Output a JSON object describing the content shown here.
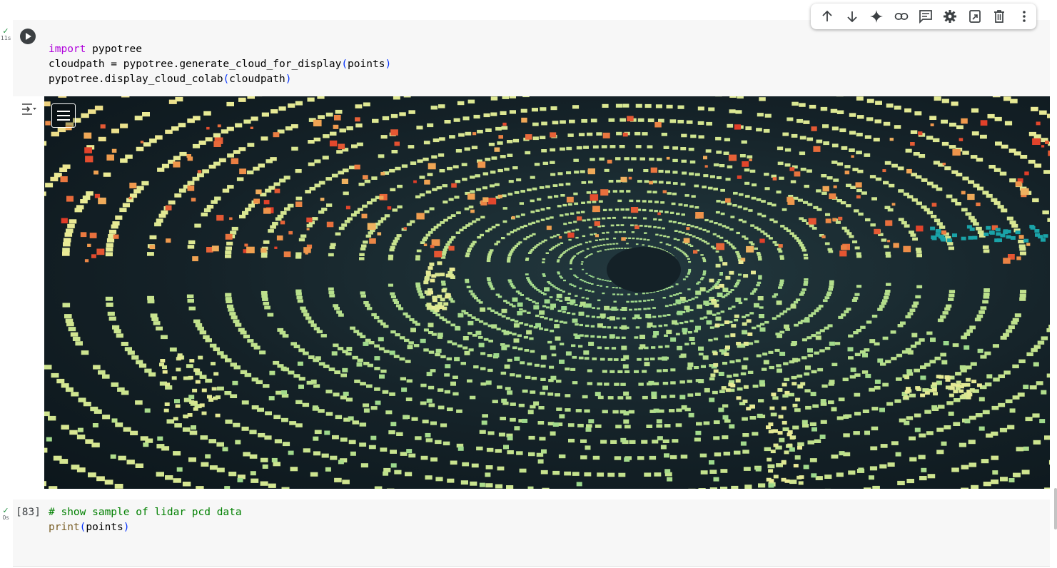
{
  "cell1": {
    "status_check": "✓",
    "duration": "11s",
    "code_lines": {
      "l1_kw": "import",
      "l1_rest": " pypotree",
      "l2_a": "cloudpath = pypotree.generate_cloud_for_display",
      "l2_open": "(",
      "l2_arg": "points",
      "l2_close": ")",
      "l3_a": "pypotree.display_cloud_colab",
      "l3_open": "(",
      "l3_arg": "cloudpath",
      "l3_close": ")"
    }
  },
  "toolbar": {
    "buttons": [
      {
        "icon": "arrow-up-icon",
        "title": "Move cell up"
      },
      {
        "icon": "arrow-down-icon",
        "title": "Move cell down"
      },
      {
        "icon": "sparkle-icon",
        "title": "Gemini"
      },
      {
        "icon": "link-icon",
        "title": "Copy link to cell"
      },
      {
        "icon": "comment-icon",
        "title": "Add comment"
      },
      {
        "icon": "gear-icon",
        "title": "Editor settings"
      },
      {
        "icon": "mirror-cell-icon",
        "title": "Mirror cell in tab"
      },
      {
        "icon": "trash-icon",
        "title": "Delete cell"
      },
      {
        "icon": "more-vert-icon",
        "title": "More cell actions"
      }
    ]
  },
  "cell2": {
    "status_check": "✓",
    "duration": "0s",
    "exec_count": "[83]",
    "line1": "# show sample of lidar pcd data",
    "line2_fn": "print",
    "line2_open": "(",
    "line2_arg": "points",
    "line2_close": ")"
  },
  "viewer": {
    "colors": {
      "background": "#142127",
      "near": "#e6f08a",
      "mid": "#9fd98a",
      "far": "#f07a2c",
      "high": "#e3262d",
      "water": "#1aa3a8"
    }
  }
}
